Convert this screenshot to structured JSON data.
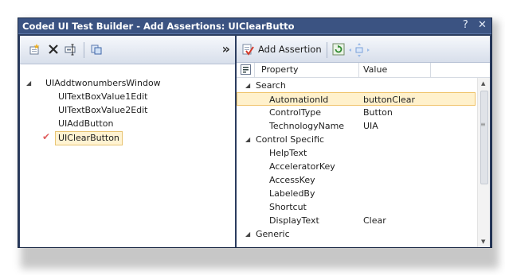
{
  "window": {
    "title": "Coded UI Test Builder - Add Assertions: UIClearButto",
    "help_glyph": "?",
    "close_glyph": "✕"
  },
  "left_toolbar": {
    "overflow_glyph": "»",
    "icons": [
      "add-control-icon",
      "delete-icon",
      "rename-icon",
      "copy-icon"
    ]
  },
  "tree": {
    "root": "UIAddtwonumbersWindow",
    "children": [
      "UITextBoxValue1Edit",
      "UITextBoxValue2Edit",
      "UIAddButton",
      "UIClearButton"
    ],
    "selected": "UIClearButton"
  },
  "right_toolbar": {
    "add_assertion_label": "Add Assertion",
    "icons": [
      "add-assertion-icon",
      "refresh-icon",
      "move-icon"
    ]
  },
  "grid": {
    "headers": {
      "property": "Property",
      "value": "Value"
    },
    "rows": [
      {
        "type": "category",
        "property": "Search",
        "value": ""
      },
      {
        "type": "item",
        "property": "AutomationId",
        "value": "buttonClear",
        "selected": true
      },
      {
        "type": "item",
        "property": "ControlType",
        "value": "Button"
      },
      {
        "type": "item",
        "property": "TechnologyName",
        "value": "UIA"
      },
      {
        "type": "category",
        "property": "Control Specific",
        "value": ""
      },
      {
        "type": "item",
        "property": "HelpText",
        "value": ""
      },
      {
        "type": "item",
        "property": "AcceleratorKey",
        "value": ""
      },
      {
        "type": "item",
        "property": "AccessKey",
        "value": ""
      },
      {
        "type": "item",
        "property": "LabeledBy",
        "value": ""
      },
      {
        "type": "item",
        "property": "Shortcut",
        "value": ""
      },
      {
        "type": "item",
        "property": "DisplayText",
        "value": "Clear"
      },
      {
        "type": "category",
        "property": "Generic",
        "value": ""
      }
    ]
  },
  "colors": {
    "title_bar": "#3b5382",
    "window_frame": "#2b3c5f",
    "selection_fill": "#fff1cc",
    "selection_border": "#f0c36a"
  }
}
